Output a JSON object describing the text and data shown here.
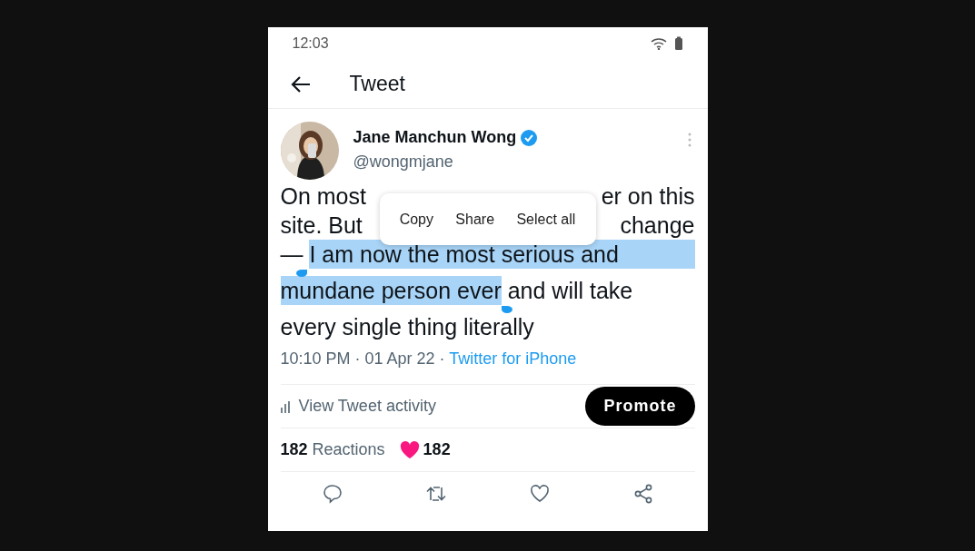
{
  "status_bar": {
    "time": "12:03"
  },
  "header": {
    "title": "Tweet"
  },
  "tweet": {
    "author": {
      "name": "Jane Manchun Wong",
      "verified": true,
      "handle": "@wongmjane"
    },
    "text_lines": [
      {
        "segments": [
          {
            "kind": "text",
            "text": "On most",
            "selected": false
          },
          {
            "kind": "gap"
          },
          {
            "kind": "text",
            "text": "er on this",
            "selected": false
          }
        ]
      },
      {
        "segments": [
          {
            "kind": "text",
            "text": "site. But",
            "selected": false
          },
          {
            "kind": "gap"
          },
          {
            "kind": "text",
            "text": "change",
            "selected": false
          }
        ]
      },
      {
        "segments": [
          {
            "kind": "text",
            "text": "— ",
            "selected": false
          },
          {
            "kind": "text",
            "text": "I am now the most serious and",
            "selected": true
          }
        ]
      },
      {
        "segments": [
          {
            "kind": "text",
            "text": "mundane person ever",
            "selected": true
          },
          {
            "kind": "text",
            "text": " and will take",
            "selected": false
          }
        ]
      },
      {
        "segments": [
          {
            "kind": "text",
            "text": "every single thing literally",
            "selected": false
          }
        ]
      }
    ],
    "context_menu": [
      "Copy",
      "Share",
      "Select all"
    ],
    "meta": {
      "text": "10:10 PM · 01 Apr 22 ·",
      "source": "Twitter for iPhone"
    },
    "activity": {
      "label": "View Tweet activity",
      "button": "Promote"
    },
    "reactions": {
      "count": "182",
      "label": "Reactions",
      "heart_count": "182"
    }
  }
}
